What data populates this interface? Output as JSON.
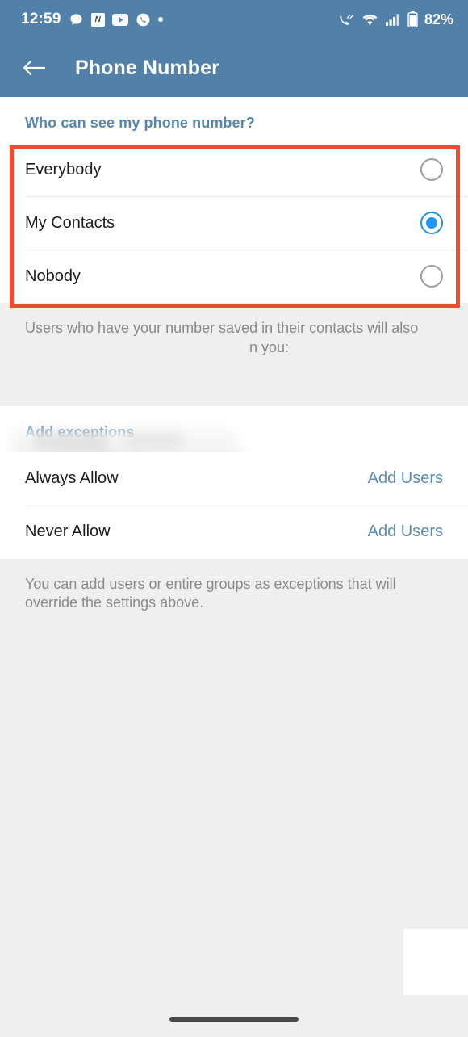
{
  "statusbar": {
    "time": "12:59",
    "battery_text": "82%",
    "left_icons": [
      "chat-bubble-icon",
      "news-icon",
      "youtube-icon",
      "phone-circle-icon",
      "dot-icon"
    ],
    "right_icons": [
      "wifi-calling-icon",
      "wifi-icon",
      "cellular-signal-icon",
      "battery-icon"
    ],
    "news_glyph": "N"
  },
  "appbar": {
    "back_label": "Back",
    "title": "Phone Number"
  },
  "privacy_section": {
    "header": "Who can see my phone number?",
    "options": [
      {
        "label": "Everybody",
        "selected": false
      },
      {
        "label": "My Contacts",
        "selected": true
      },
      {
        "label": "Nobody",
        "selected": false
      }
    ],
    "description_before": "Users who have your number saved in their contacts will also",
    "description_after": "n you:"
  },
  "exceptions_section": {
    "header": "Add exceptions",
    "rows": [
      {
        "label": "Always Allow",
        "action": "Add Users"
      },
      {
        "label": "Never Allow",
        "action": "Add Users"
      }
    ],
    "footnote": "You can add users or entire groups as exceptions that will override the settings above."
  },
  "colors": {
    "appbar": "#5180a8",
    "accent": "#5686ad",
    "link": "#5b8cb3",
    "radio_selected": "#2196f3",
    "annotation": "#f04b2e",
    "background": "#efefef"
  },
  "navbar": {
    "pill": "gesture-nav-pill"
  }
}
